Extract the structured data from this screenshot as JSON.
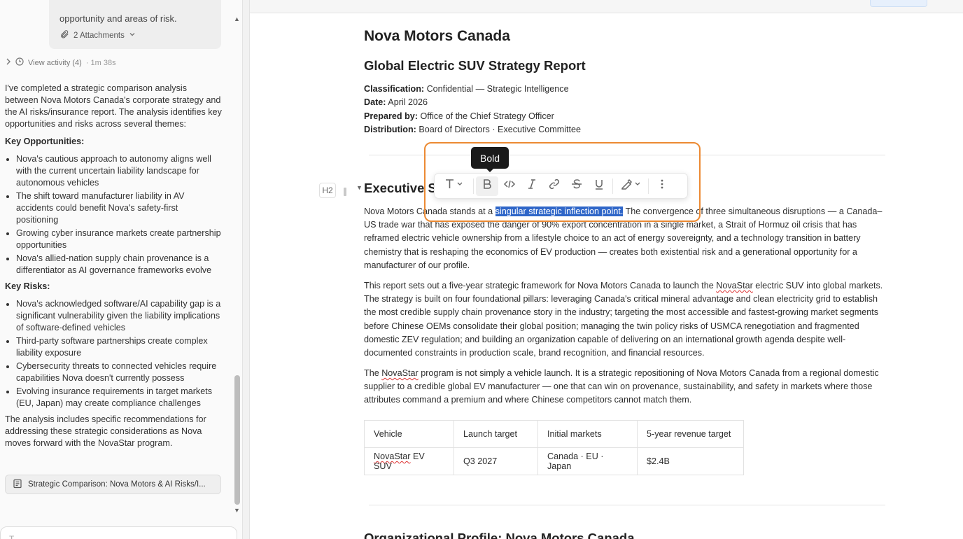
{
  "chat_panel": {
    "attachment_text": "opportunity and areas of risk.",
    "attachments_label": "2 Attachments",
    "activity_label": "View activity (4)",
    "activity_time": "· 1m 38s",
    "intro": "I've completed a strategic comparison analysis between Nova Motors Canada's corporate strategy and the AI risks/insurance report. The analysis identifies key opportunities and risks across several themes:",
    "opportunities_heading": "Key Opportunities:",
    "opportunities": [
      "Nova's cautious approach to autonomy aligns well with the current uncertain liability landscape for autonomous vehicles",
      "The shift toward manufacturer liability in AV accidents could benefit Nova's safety-first positioning",
      "Growing cyber insurance markets create partnership opportunities",
      "Nova's allied-nation supply chain provenance is a differentiator as AI governance frameworks evolve"
    ],
    "risks_heading": "Key Risks:",
    "risks": [
      "Nova's acknowledged software/AI capability gap is a significant vulnerability given the liability implications of software-defined vehicles",
      "Third-party software partnerships create complex liability exposure",
      "Cybersecurity threats to connected vehicles require capabilities Nova doesn't currently possess",
      "Evolving insurance requirements in target markets (EU, Japan) may create compliance challenges"
    ],
    "conclusion": "The analysis includes specific recommendations for addressing these strategic considerations as Nova moves forward with the NovaStar program.",
    "artifact_label": "Strategic Comparison: Nova Motors & AI Risks/I...",
    "composer_placeholder": "T"
  },
  "document": {
    "title": "Nova Motors Canada",
    "subtitle": "Global Electric SUV Strategy Report",
    "meta": [
      {
        "label": "Classification:",
        "value": " Confidential — Strategic Intelligence"
      },
      {
        "label": "Date:",
        "value": " April 2026"
      },
      {
        "label": "Prepared by:",
        "value": " Office of the Chief Strategy Officer"
      },
      {
        "label": "Distribution:",
        "value": " Board of Directors · Executive Committee"
      }
    ],
    "heading_level_badge": "H2",
    "exec_heading": "Executive Su",
    "p1_before": "Nova Motors Canada stands at a ",
    "p1_selected": "singular strategic inflection point.",
    "p1_after": " The convergence of three simultaneous disruptions — a Canada–US trade war that has exposed the danger of 90% export concentration in a single market, a Strait of Hormuz oil crisis that has reframed electric vehicle ownership from a lifestyle choice to an act of energy sovereignty, and a technology transition in battery chemistry that is reshaping the economics of EV production — creates both existential risk and a generational opportunity for a manufacturer of our profile.",
    "p2_before": "This report sets out a five-year strategic framework for Nova Motors Canada to launch the ",
    "p2_brand": "NovaStar",
    "p2_after": " electric SUV into global markets. The strategy is built on four foundational pillars: leveraging Canada's critical mineral advantage and clean electricity grid to establish the most credible supply chain provenance story in the industry; targeting the most accessible and fastest-growing market segments before Chinese OEMs consolidate their global position; managing the twin policy risks of USMCA renegotiation and fragmented domestic ZEV regulation; and building an organization capable of delivering on an international growth agenda despite well-documented constraints in production scale, brand recognition, and financial resources.",
    "p3_before": "The ",
    "p3_brand": "NovaStar",
    "p3_after": " program is not simply a vehicle launch. It is a strategic repositioning of Nova Motors Canada from a regional domestic supplier to a credible global EV manufacturer — one that can win on provenance, sustainability, and safety in markets where those attributes command a premium and where Chinese competitors cannot match them.",
    "table": {
      "headers": [
        "Vehicle",
        "Launch target",
        "Initial markets",
        "5-year revenue target"
      ],
      "row_brand": "NovaStar",
      "row_vehicle_rest": " EV SUV",
      "row": [
        "NovaStar EV SUV",
        "Q3 2027",
        "Canada · EU · Japan",
        "$2.4B"
      ]
    },
    "next_heading": "Organizational Profile: Nova Motors Canada"
  },
  "toolbar": {
    "tooltip": "Bold",
    "buttons": [
      "text-style-icon",
      "bold-icon",
      "code-icon",
      "italic-icon",
      "link-icon",
      "strikethrough-icon",
      "underline-icon",
      "highlight-icon",
      "more-icon"
    ]
  },
  "colors": {
    "selection": "#2f66c8",
    "highlight_box": "#ec8a33"
  }
}
